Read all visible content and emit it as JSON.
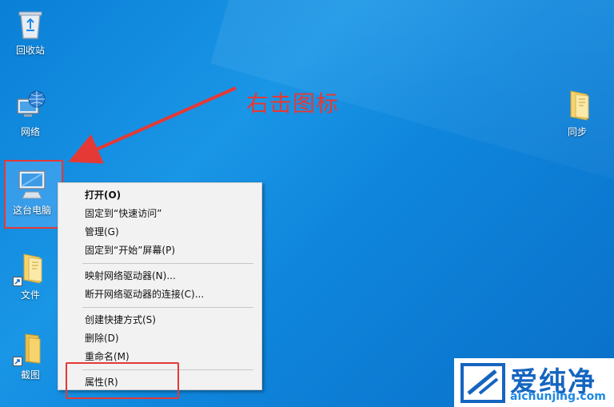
{
  "desktop": {
    "icons": [
      {
        "label": "回收站",
        "icon": "recycle-bin-icon"
      },
      {
        "label": "网络",
        "icon": "network-globe-icon"
      },
      {
        "label": "这台电脑",
        "icon": "computer-monitor-icon"
      },
      {
        "label": "文件",
        "icon": "folder-shortcut-icon"
      },
      {
        "label": "截图",
        "icon": "folder-shortcut-icon"
      },
      {
        "label": "同步",
        "icon": "sync-folder-icon"
      }
    ]
  },
  "annotation": {
    "text": "右击图标",
    "color": "#e53935"
  },
  "context_menu": {
    "items": [
      {
        "label": "打开(O)",
        "bold": true
      },
      {
        "label": "固定到“快速访问”"
      },
      {
        "label": "管理(G)"
      },
      {
        "label": "固定到“开始”屏幕(P)"
      },
      {
        "label": "映射网络驱动器(N)..."
      },
      {
        "label": "断开网络驱动器的连接(C)..."
      },
      {
        "label": "创建快捷方式(S)"
      },
      {
        "label": "删除(D)"
      },
      {
        "label": "重命名(M)"
      },
      {
        "label": "属性(R)"
      }
    ]
  },
  "watermark": {
    "title": "爱纯净",
    "url": "aichunjing.com"
  },
  "colors": {
    "desktop_bg": "#1a96e6",
    "highlight_red": "#e53935",
    "brand_blue": "#1565c0"
  }
}
